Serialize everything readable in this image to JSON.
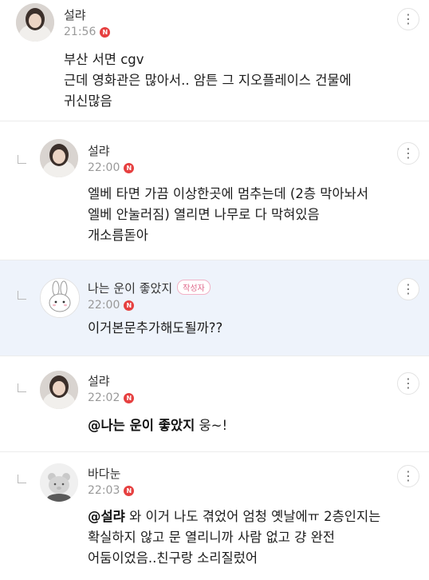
{
  "comments": [
    {
      "author": "설랴",
      "time": "21:56",
      "lines": [
        "부산 서면 cgv",
        "근데 영화관은 많아서.. 암튼 그 지오플레이스 건물에",
        "귀신많음"
      ]
    },
    {
      "author": "설랴",
      "time": "22:00",
      "lines": [
        "엘베 타면 가끔 이상한곳에 멈추는데 (2층 막아놔서",
        "엘베 안눌러짐) 열리면 나무로 다 막혀있음",
        "개소름돋아"
      ]
    },
    {
      "author": "나는 운이 좋았지",
      "badge": "작성자",
      "time": "22:00",
      "lines": [
        "이거본문추가해도될까??"
      ]
    },
    {
      "author": "설랴",
      "time": "22:02",
      "mention": "@나는 운이 좋았지",
      "rest": " 웅~!"
    },
    {
      "author": "바다눈",
      "time": "22:03",
      "mention": "@설랴",
      "rest": " 와 이거 나도 겪었어 엄청 옛날에ㅠ 2층인지는",
      "lines": [
        "확실하지 않고 문 열리니까 사람 없고 걍 완전",
        "어둠이었음..친구랑 소리질렀어"
      ]
    }
  ],
  "icons": {
    "more": "more-vertical-icon",
    "naver": "N",
    "reply": "reply-arrow-icon"
  },
  "colors": {
    "highlight": "#eef3fb",
    "badge_red": "#e64040",
    "writer_pink": "#e06a8c"
  }
}
